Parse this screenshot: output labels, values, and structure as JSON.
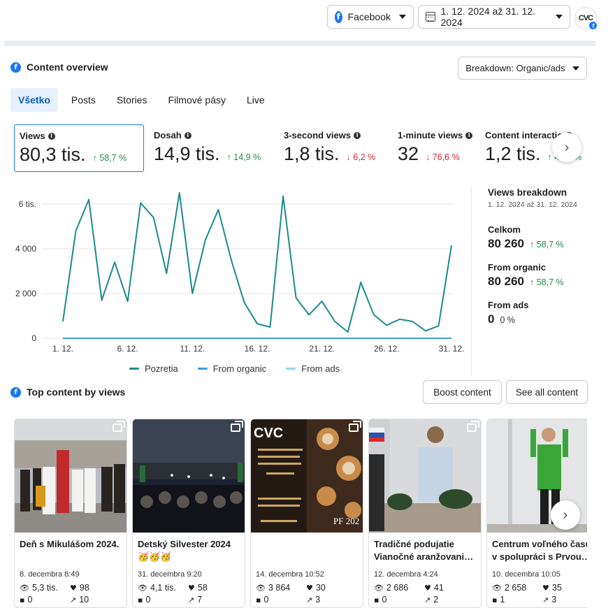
{
  "header": {
    "platform": {
      "label": "Facebook",
      "icon": "facebook-icon"
    },
    "date_range": {
      "label": "1. 12. 2024 až 31. 12. 2024",
      "icon": "calendar-icon"
    },
    "avatar_text": "CVC"
  },
  "overview": {
    "title": "Content overview",
    "breakdown_button": "Breakdown: Organic/ads",
    "tabs": [
      {
        "label": "Všetko",
        "active": true
      },
      {
        "label": "Posts"
      },
      {
        "label": "Stories"
      },
      {
        "label": "Filmové pásy"
      },
      {
        "label": "Live"
      }
    ],
    "metrics": [
      {
        "label": "Views",
        "value": "80,3 tis.",
        "delta": "↑ 58,7 %",
        "trend": "up",
        "selected": true
      },
      {
        "label": "Dosah",
        "value": "14,9 tis.",
        "delta": "↑ 14,9 %",
        "trend": "up"
      },
      {
        "label": "3-second views",
        "value": "1,8 tis.",
        "delta": "↓ 6,2 %",
        "trend": "down"
      },
      {
        "label": "1-minute views",
        "value": "32",
        "delta": "↓ 76,6 %",
        "trend": "down"
      },
      {
        "label": "Content interactio",
        "value": "1,2 tis.",
        "delta": "↑ 49,9 %",
        "trend": "up"
      }
    ]
  },
  "chart_data": {
    "type": "line",
    "ylim": [
      0,
      7000
    ],
    "y_ticks": [
      {
        "value": 0,
        "label": "0"
      },
      {
        "value": 2000,
        "label": "2 000"
      },
      {
        "value": 4000,
        "label": "4 000"
      },
      {
        "value": 6000,
        "label": "6 tis."
      }
    ],
    "x_ticks": [
      {
        "day": 1,
        "label": "1. 12."
      },
      {
        "day": 6,
        "label": "6. 12."
      },
      {
        "day": 11,
        "label": "11. 12."
      },
      {
        "day": 16,
        "label": "16. 12."
      },
      {
        "day": 21,
        "label": "21. 12."
      },
      {
        "day": 26,
        "label": "26. 12."
      },
      {
        "day": 31,
        "label": "31. 12."
      }
    ],
    "x": [
      1,
      2,
      3,
      4,
      5,
      6,
      7,
      8,
      9,
      10,
      11,
      12,
      13,
      14,
      15,
      16,
      17,
      18,
      19,
      20,
      21,
      22,
      23,
      24,
      25,
      26,
      27,
      28,
      29,
      30,
      31
    ],
    "series": [
      {
        "name": "Pozretia",
        "color": "#1b8a8f",
        "values": [
          750,
          4800,
          6200,
          1700,
          3400,
          1650,
          6050,
          5400,
          2900,
          6500,
          2000,
          4400,
          5750,
          3500,
          1600,
          650,
          500,
          6350,
          1800,
          1050,
          1650,
          750,
          280,
          2500,
          1050,
          580,
          850,
          750,
          330,
          550,
          4150
        ]
      },
      {
        "name": "From organic",
        "color": "#3a9fd8",
        "values": [
          0,
          0,
          0,
          0,
          0,
          0,
          0,
          0,
          0,
          0,
          0,
          0,
          0,
          0,
          0,
          0,
          0,
          0,
          0,
          0,
          0,
          0,
          0,
          0,
          0,
          0,
          0,
          0,
          0,
          0,
          0
        ]
      },
      {
        "name": "From ads",
        "color": "#8fd6ee",
        "values": [
          0,
          0,
          0,
          0,
          0,
          0,
          0,
          0,
          0,
          0,
          0,
          0,
          0,
          0,
          0,
          0,
          0,
          0,
          0,
          0,
          0,
          0,
          0,
          0,
          0,
          0,
          0,
          0,
          0,
          0,
          0
        ]
      }
    ]
  },
  "breakdown": {
    "title": "Views breakdown",
    "date": "1. 12. 2024 až 31. 12. 2024",
    "total": {
      "label": "Celkom",
      "value": "80 260",
      "delta": "↑ 58,7 %"
    },
    "organic": {
      "label": "From organic",
      "value": "80 260",
      "delta": "↑ 58,7 %"
    },
    "ads": {
      "label": "From ads",
      "value": "0",
      "delta": "0 %"
    }
  },
  "top_content": {
    "title": "Top content by views",
    "boost_label": "Boost content",
    "see_all_label": "See all content",
    "cards": [
      {
        "title": "Deň s Mikulášom 2024.",
        "date": "8. decembra 8:49",
        "views": "5,3 tis.",
        "likes": "98",
        "comments": "0",
        "shares": "10",
        "multi": true
      },
      {
        "title": "Detský Silvester 2024 🥳🥳🥳",
        "date": "31. decembra 9:20",
        "views": "4,1 tis.",
        "likes": "58",
        "comments": "0",
        "shares": "7",
        "multi": true
      },
      {
        "title": "",
        "date": "14. decembra 10:52",
        "views": "3 864",
        "likes": "30",
        "comments": "0",
        "shares": "3",
        "multi": true,
        "poster_lines": [
          "CVC",
          "PF 202"
        ]
      },
      {
        "title": "Tradičné podujatie Vianočné aranžovani…",
        "date": "12. decembra 4:24",
        "views": "2 686",
        "likes": "41",
        "comments": "0",
        "shares": "2",
        "multi": true
      },
      {
        "title": "Centrum voľného času v spolupráci s Prvou…",
        "date": "10. decembra 10:05",
        "views": "2 658",
        "likes": "35",
        "comments": "1",
        "shares": "3",
        "multi": false
      }
    ]
  }
}
